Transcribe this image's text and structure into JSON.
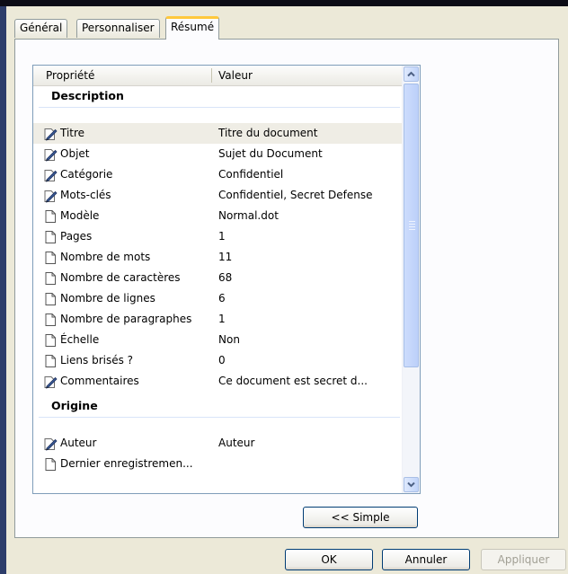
{
  "tabs": [
    {
      "label": "Général"
    },
    {
      "label": "Personnaliser"
    },
    {
      "label": "Résumé"
    }
  ],
  "list": {
    "columns": [
      "Propriété",
      "Valeur"
    ],
    "groups": [
      {
        "title": "Description",
        "rows": [
          {
            "icon": "edit-property-icon",
            "name": "Titre",
            "value": "Titre du document"
          },
          {
            "icon": "edit-property-icon",
            "name": "Objet",
            "value": "Sujet du Document"
          },
          {
            "icon": "edit-property-icon",
            "name": "Catégorie",
            "value": "Confidentiel"
          },
          {
            "icon": "edit-property-icon",
            "name": "Mots-clés",
            "value": "Confidentiel, Secret Defense"
          },
          {
            "icon": "document-icon",
            "name": "Modèle",
            "value": "Normal.dot"
          },
          {
            "icon": "document-icon",
            "name": "Pages",
            "value": "1"
          },
          {
            "icon": "document-icon",
            "name": "Nombre de mots",
            "value": "11"
          },
          {
            "icon": "document-icon",
            "name": "Nombre de caractères",
            "value": "68"
          },
          {
            "icon": "document-icon",
            "name": "Nombre de lignes",
            "value": "6"
          },
          {
            "icon": "document-icon",
            "name": "Nombre de paragraphes",
            "value": "1"
          },
          {
            "icon": "document-icon",
            "name": "Échelle",
            "value": "Non"
          },
          {
            "icon": "document-icon",
            "name": "Liens brisés ?",
            "value": "0"
          },
          {
            "icon": "edit-property-icon",
            "name": "Commentaires",
            "value": "Ce document est secret d..."
          }
        ]
      },
      {
        "title": "Origine",
        "rows": [
          {
            "icon": "edit-property-icon",
            "name": "Auteur",
            "value": "Auteur"
          },
          {
            "icon": "document-icon",
            "name": "Dernier enregistremen...",
            "value": ""
          }
        ]
      }
    ]
  },
  "buttons": {
    "simple": "<< Simple",
    "ok": "OK",
    "cancel": "Annuler",
    "apply": "Appliquer"
  },
  "colors": {
    "active_tab_accent": "#ffc83c",
    "selected_row": "#efede5"
  }
}
